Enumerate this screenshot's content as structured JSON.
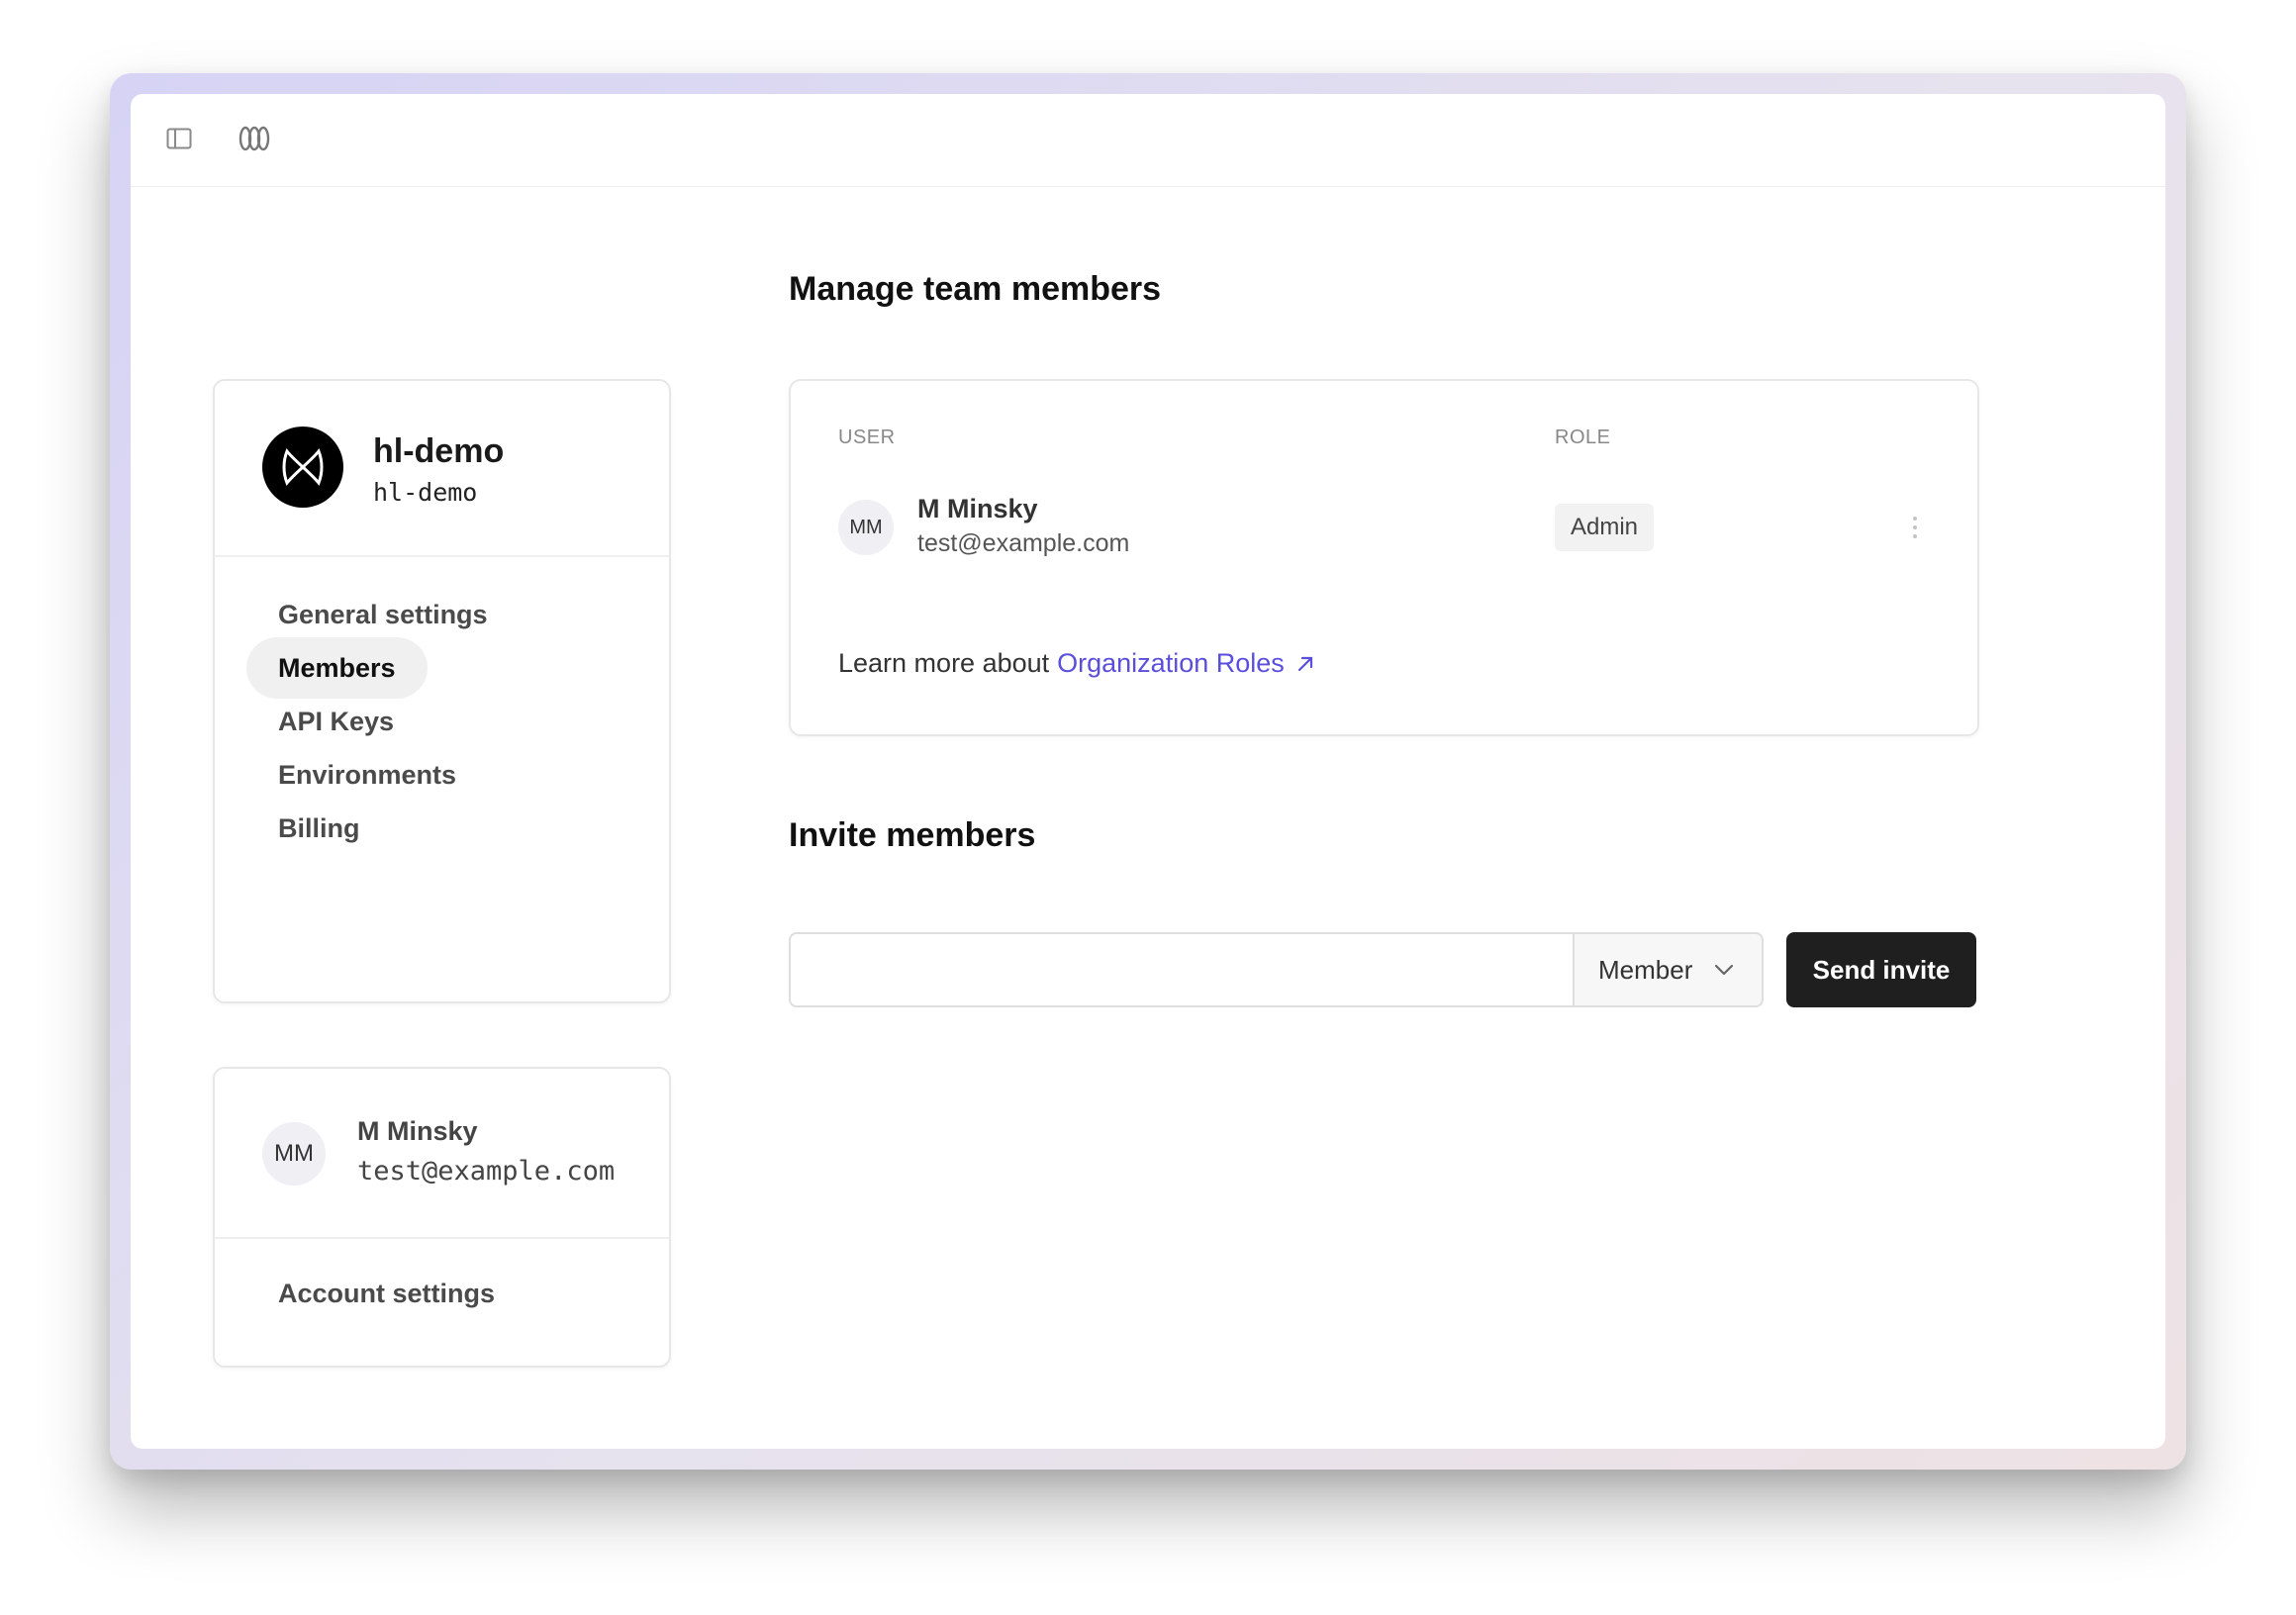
{
  "org": {
    "name": "hl-demo",
    "slug": "hl-demo"
  },
  "nav": {
    "items": [
      {
        "label": "General settings",
        "active": false
      },
      {
        "label": "Members",
        "active": true
      },
      {
        "label": "API Keys",
        "active": false
      },
      {
        "label": "Environments",
        "active": false
      },
      {
        "label": "Billing",
        "active": false
      }
    ]
  },
  "current_user": {
    "initials": "MM",
    "name": "M Minsky",
    "email": "test@example.com",
    "account_settings_label": "Account settings"
  },
  "team": {
    "title": "Manage team members",
    "columns": {
      "user": "USER",
      "role": "ROLE"
    },
    "members": [
      {
        "initials": "MM",
        "name": "M Minsky",
        "email": "test@example.com",
        "role": "Admin"
      }
    ],
    "learn_more_prefix": "Learn more about",
    "learn_more_link": "Organization Roles"
  },
  "invite": {
    "title": "Invite members",
    "email_value": "",
    "email_placeholder": "",
    "role_selected": "Member",
    "send_label": "Send invite"
  },
  "icons": {
    "panel_toggle": "sidebar-toggle-icon",
    "app_logo": "app-logo-icon",
    "org_logo": "org-logo-icon",
    "external_link": "external-link-icon",
    "chevron": "chevron-down-icon",
    "more": "more-vertical-icon"
  },
  "colors": {
    "link": "#5a4fdb",
    "primary_button": "#1f1f1f",
    "active_nav_bg": "#f0f0f0"
  }
}
